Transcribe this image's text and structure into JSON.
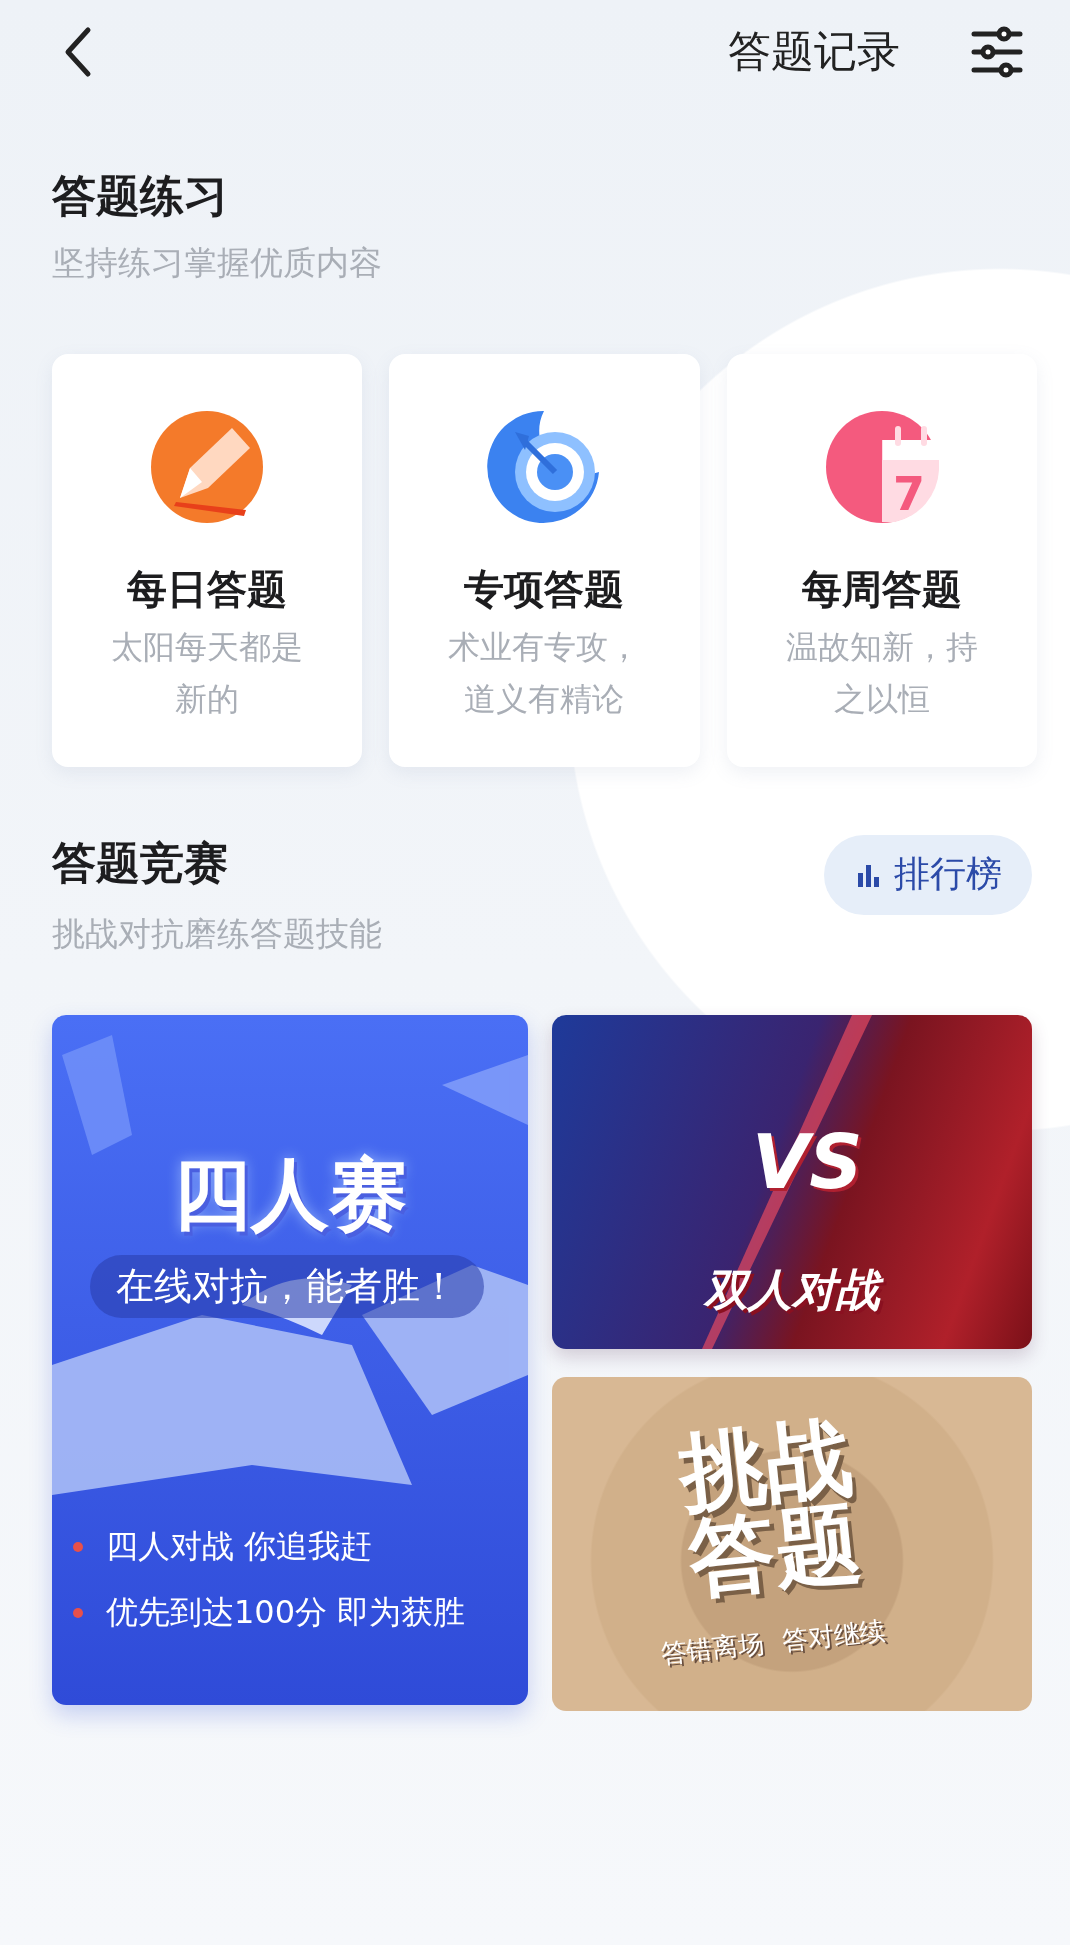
{
  "header": {
    "title": "答题记录"
  },
  "practice": {
    "title": "答题练习",
    "subtitle": "坚持练习掌握优质内容",
    "cards": [
      {
        "kind": "pencil",
        "title": "每日答题",
        "description": "太阳每天都是新的"
      },
      {
        "kind": "target",
        "title": "专项答题",
        "description": "术业有专攻，道义有精论"
      },
      {
        "kind": "calendar",
        "title": "每周答题",
        "description": "温故知新，持之以恒",
        "icon_text": "7"
      }
    ]
  },
  "competition": {
    "title": "答题竞赛",
    "subtitle": "挑战对抗磨练答题技能",
    "ranking_button": "排行榜",
    "four_player": {
      "title": "四人赛",
      "tagline": "在线对抗，能者胜！",
      "bullets": [
        "四人对战 你追我赶",
        "优先到达100分 即为获胜"
      ]
    },
    "duel": {
      "badge": "VS",
      "title": "双人对战"
    },
    "challenge": {
      "title": "挑战答题",
      "tags": [
        "答错离场",
        "答对继续"
      ]
    }
  }
}
